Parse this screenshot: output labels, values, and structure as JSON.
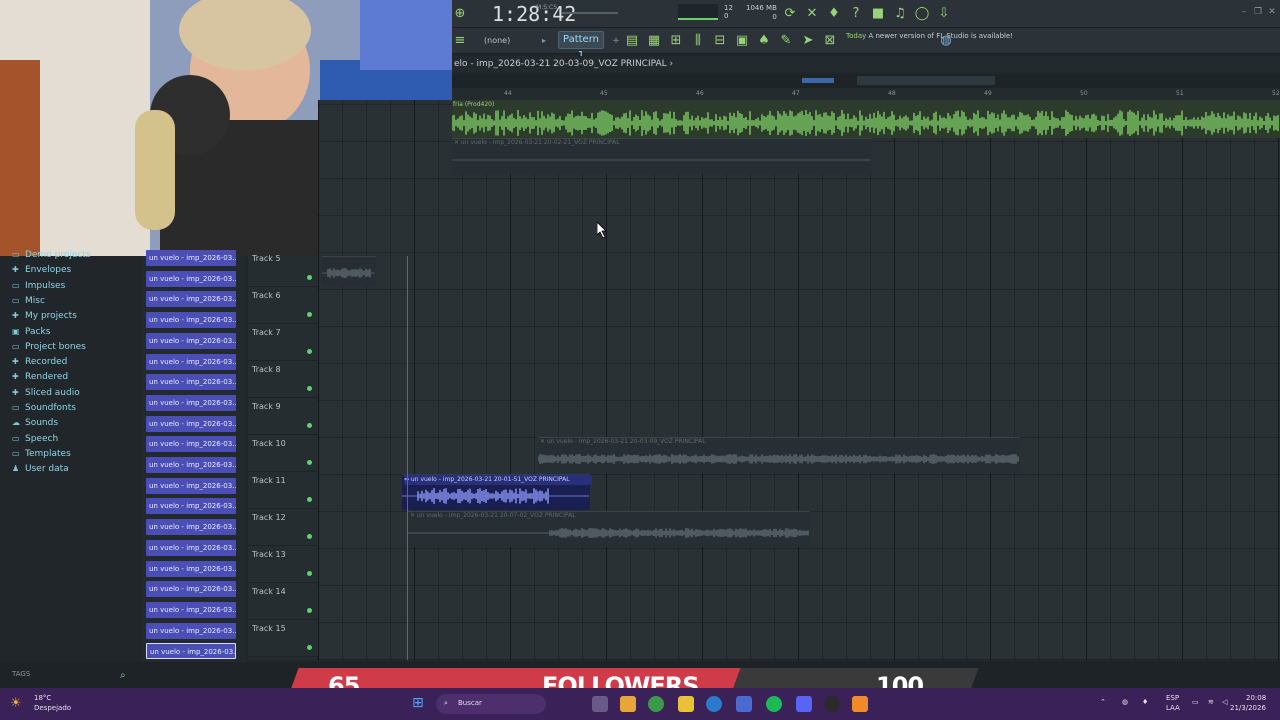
{
  "toolbar": {
    "time": "1:28:42",
    "time_unit": "M:S:CS",
    "cpu": "12",
    "cpu_sub": "0",
    "memory": "1046 MB",
    "memory_sub": "0",
    "pattern_none": "(none)",
    "pattern": "Pattern 1",
    "news_date": "Today",
    "news_text": "A newer version of FL Studio is available!"
  },
  "playlist": {
    "title": "elo - imp_2026-03-21 20-03-09_VOZ PRINCIPAL ›",
    "ruler": [
      "44",
      "45",
      "46",
      "47",
      "48",
      "49",
      "50",
      "51",
      "52"
    ],
    "beat_clip_label": "fria (Prod420)",
    "clips": [
      {
        "label": "✕ un vuelo - imp_2026-03-21 20-02-21_VOZ PRINCIPAL"
      },
      {
        "label": "✕ un vuelo - imp_2026-03-21 20-03-09_VOZ PRINCIPAL"
      },
      {
        "label": "⇔ un vuelo - imp_2026-03-21 20-01-51_VOZ PRINCIPAL"
      },
      {
        "label": "✕ un vuelo - imp_2026-03-21 20-07-02_VOZ PRINCIPAL"
      }
    ],
    "tracks": [
      "Track 5",
      "Track 6",
      "Track 7",
      "Track 8",
      "Track 9",
      "Track 10",
      "Track 11",
      "Track 12",
      "Track 13",
      "Track 14",
      "Track 15"
    ]
  },
  "browser": {
    "items": [
      {
        "icon": "folder-icon",
        "label": "Demo projects"
      },
      {
        "icon": "plus-icon",
        "label": "Envelopes"
      },
      {
        "icon": "folder-icon",
        "label": "Impulses"
      },
      {
        "icon": "folder-icon",
        "label": "Misc"
      },
      {
        "icon": "plus-icon",
        "label": "My projects"
      },
      {
        "icon": "packs-icon",
        "label": "Packs"
      },
      {
        "icon": "folder-icon",
        "label": "Project bones"
      },
      {
        "icon": "plus-icon",
        "label": "Recorded"
      },
      {
        "icon": "plus-icon",
        "label": "Rendered"
      },
      {
        "icon": "plus-icon",
        "label": "Sliced audio"
      },
      {
        "icon": "folder-icon",
        "label": "Soundfonts"
      },
      {
        "icon": "cloud-icon",
        "label": "Sounds"
      },
      {
        "icon": "folder-icon",
        "label": "Speech"
      },
      {
        "icon": "folder-icon",
        "label": "Templates"
      },
      {
        "icon": "user-icon",
        "label": "User data"
      }
    ],
    "tags_label": "TAGS",
    "picker_label": "un vuelo - imp_2026-03..."
  },
  "overlay": {
    "followers_current": "65",
    "followers_label": "FOLLOWERS",
    "followers_goal": "100",
    "followers_progress": 0.65
  },
  "taskbar": {
    "weather_temp": "18°C",
    "weather_desc": "Despejado",
    "search_placeholder": "Buscar",
    "lang": "ESP",
    "lang_sub": "LAA",
    "clock_time": "20:08",
    "clock_date": "21/3/2026"
  }
}
